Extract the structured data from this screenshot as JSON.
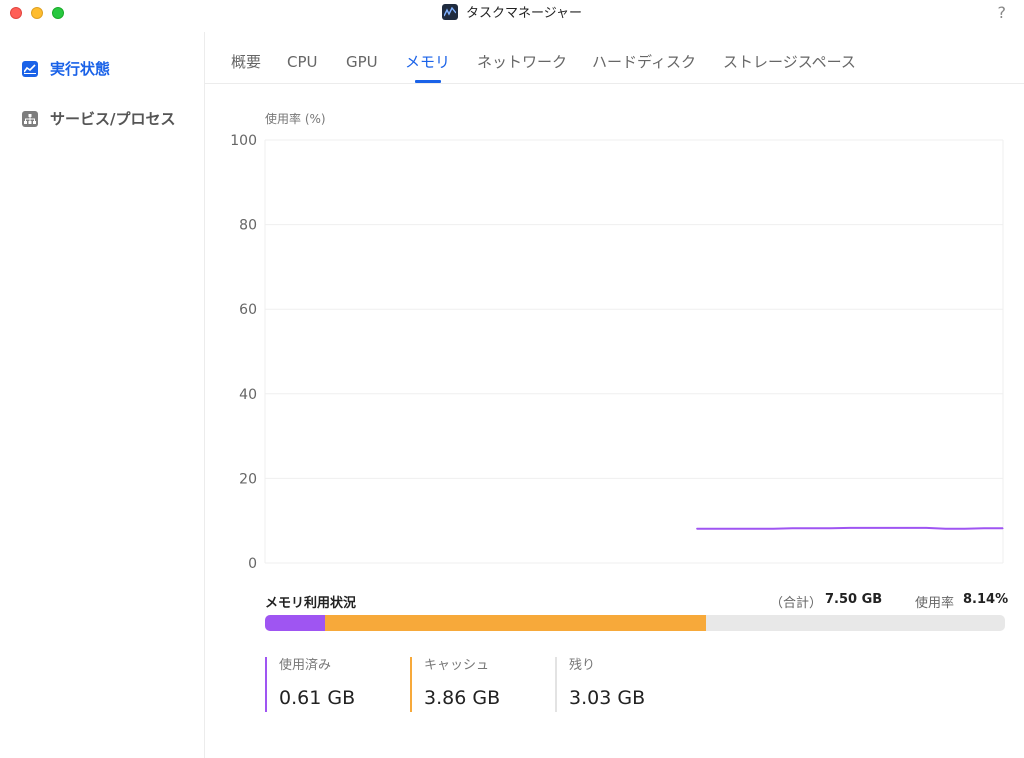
{
  "window": {
    "title": "タスクマネージャー",
    "help_label": "?"
  },
  "sidebar": {
    "items": [
      {
        "label": "実行状態",
        "icon": "chart-trend-icon",
        "active": true
      },
      {
        "label": "サービス/プロセス",
        "icon": "hierarchy-icon",
        "active": false
      }
    ]
  },
  "tabs": [
    {
      "label": "概要",
      "active": false
    },
    {
      "label": "CPU",
      "active": false
    },
    {
      "label": "GPU",
      "active": false
    },
    {
      "label": "メモリ",
      "active": true
    },
    {
      "label": "ネットワーク",
      "active": false
    },
    {
      "label": "ハードディスク",
      "active": false
    },
    {
      "label": "ストレージスペース",
      "active": false
    }
  ],
  "chart_data": {
    "type": "line",
    "ylabel": "使用率 (%)",
    "ylim": [
      0,
      100
    ],
    "y_ticks": [
      "100",
      "80",
      "60",
      "40",
      "20",
      "0"
    ],
    "grid": true,
    "series": [
      {
        "color": "#9f55f2",
        "values": [
          8.1,
          8.1,
          8.1,
          8.1,
          8.1,
          8.2,
          8.2,
          8.2,
          8.3,
          8.3,
          8.3,
          8.3,
          8.3,
          8.1,
          8.1,
          8.2,
          8.2
        ]
      }
    ],
    "series_start_fraction": 0.585
  },
  "usage": {
    "title": "メモリ利用状況",
    "total_label": "（合計）",
    "total_value": "7.50 GB",
    "rate_label": "使用率",
    "rate_value": "8.14%",
    "used_gb": 0.61,
    "cache_gb": 3.86,
    "free_gb": 3.03,
    "total_gb": 7.5,
    "stats": {
      "used": {
        "label": "使用済み",
        "value": "0.61 GB",
        "color": "#9f55f2"
      },
      "cache": {
        "label": "キャッシュ",
        "value": "3.86 GB",
        "color": "#f7a93a"
      },
      "free": {
        "label": "残り",
        "value": "3.03 GB",
        "color": "#e3e3e3"
      }
    }
  }
}
